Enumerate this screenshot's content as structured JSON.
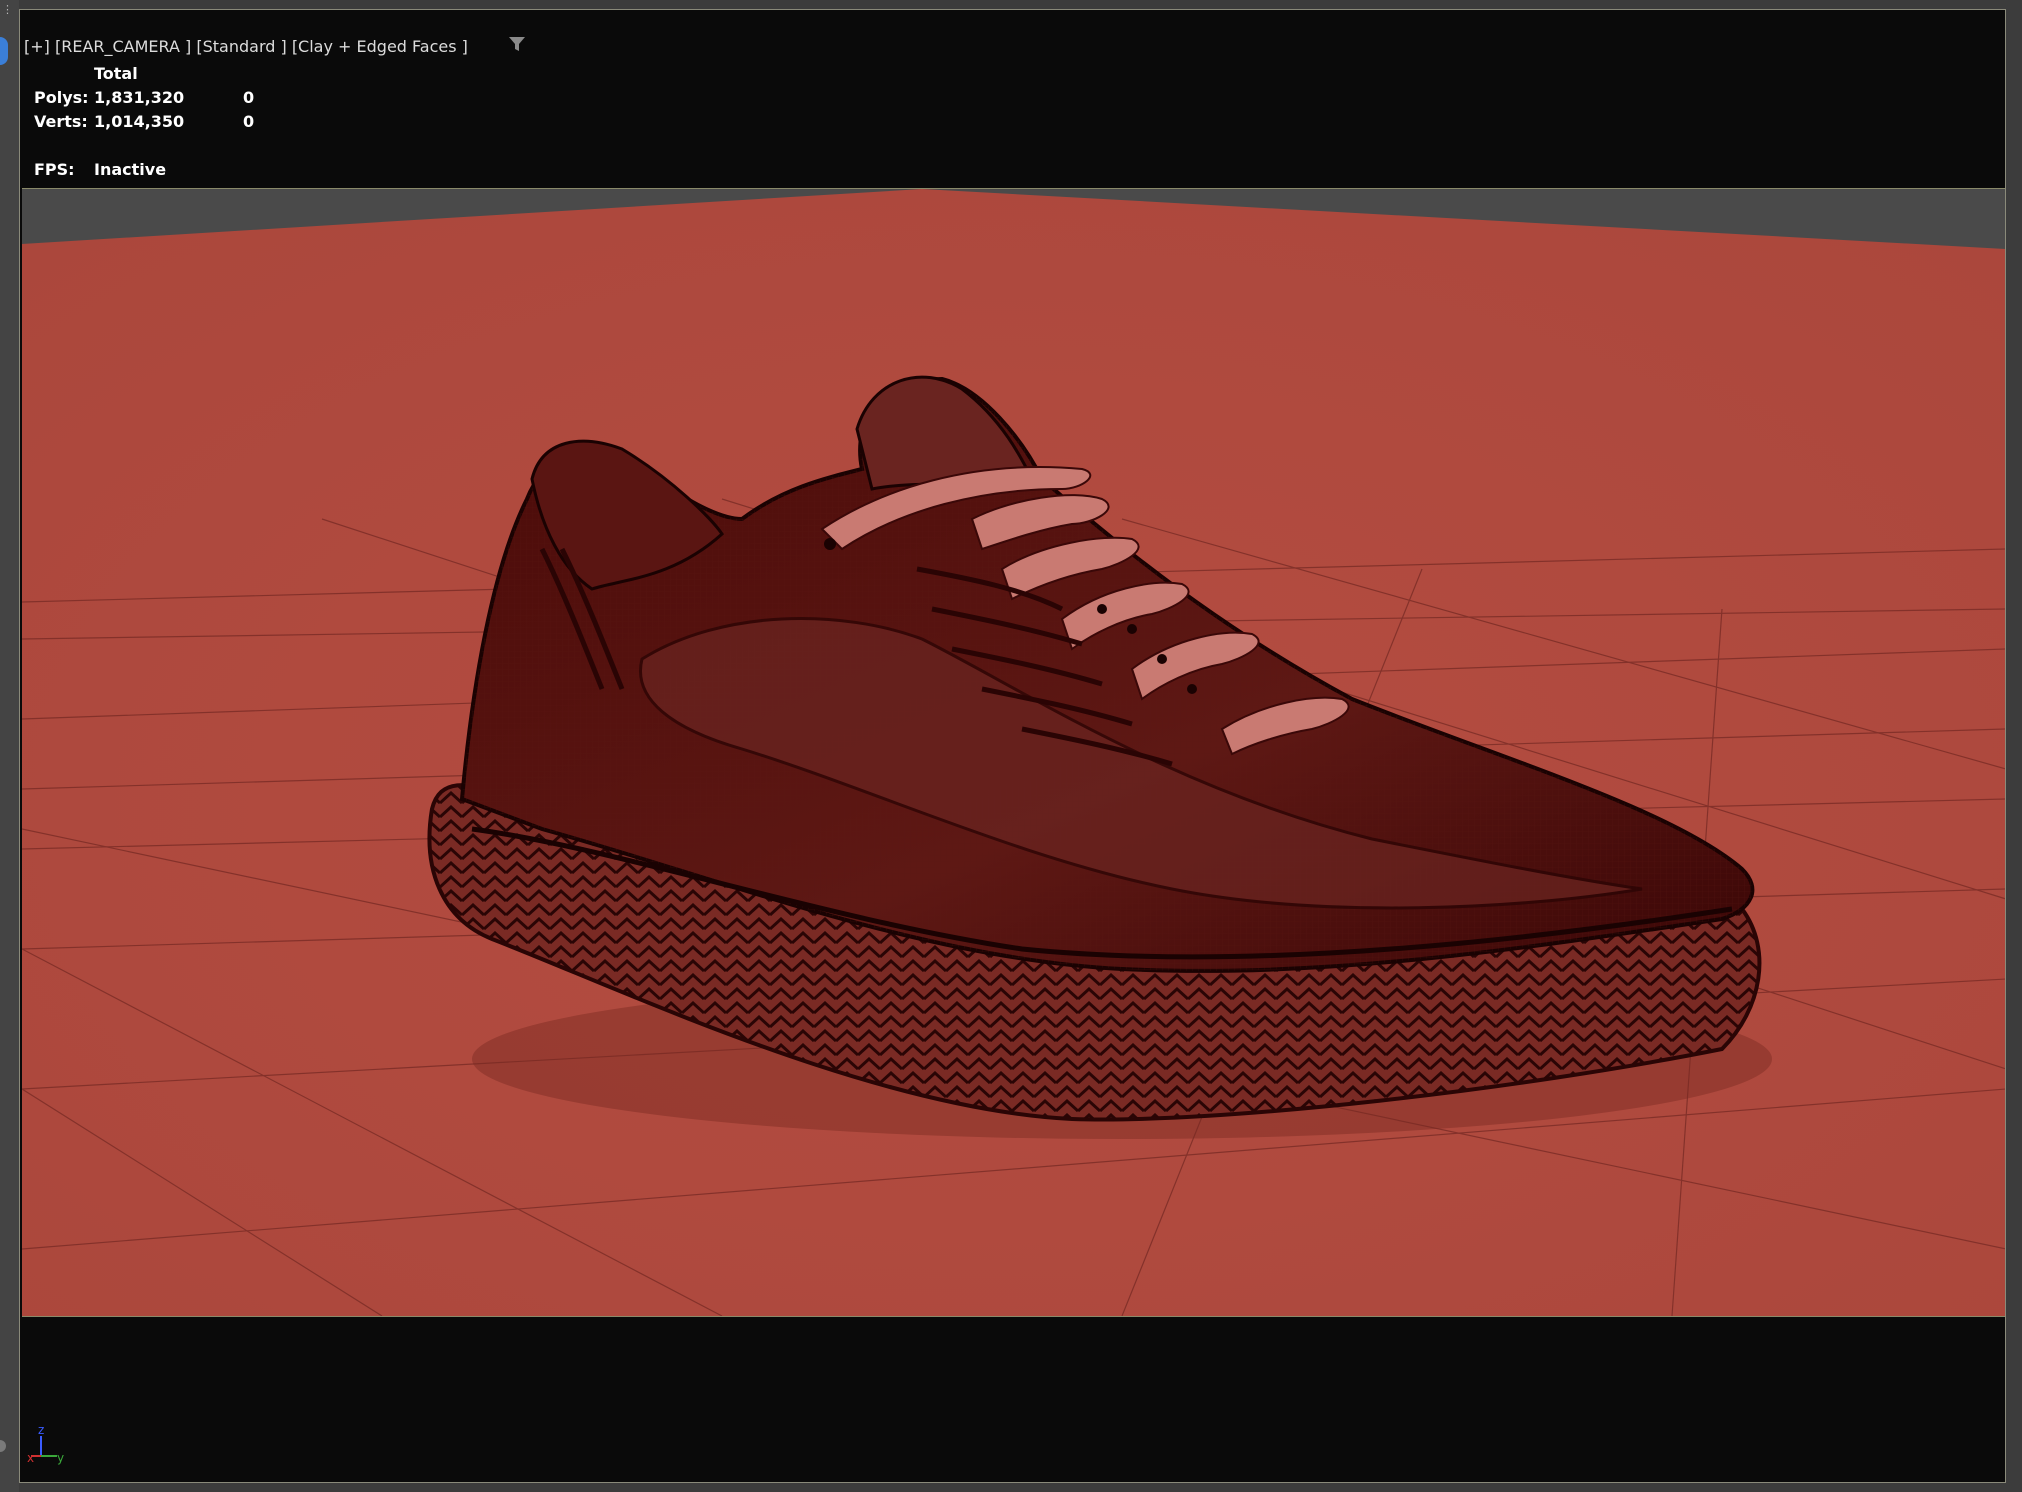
{
  "viewport": {
    "label": "[+] [REAR_CAMERA ] [Standard ] [Clay + Edged Faces ]",
    "filter_icon": "filter-funnel-icon",
    "stats": {
      "header": "Total",
      "polys_label": "Polys:",
      "polys_total": "1,831,320",
      "polys_selected": "0",
      "verts_label": "Verts:",
      "verts_total": "1,014,350",
      "verts_selected": "0",
      "fps_label": "FPS:",
      "fps_value": "Inactive"
    },
    "axis_gizmo": {
      "x": "x",
      "y": "y",
      "z": "z"
    }
  },
  "colors": {
    "floor": "#b04b40",
    "shoe": "#3c0707",
    "background": "#0a0a0a",
    "accent_blue": "#3b7fd8"
  }
}
